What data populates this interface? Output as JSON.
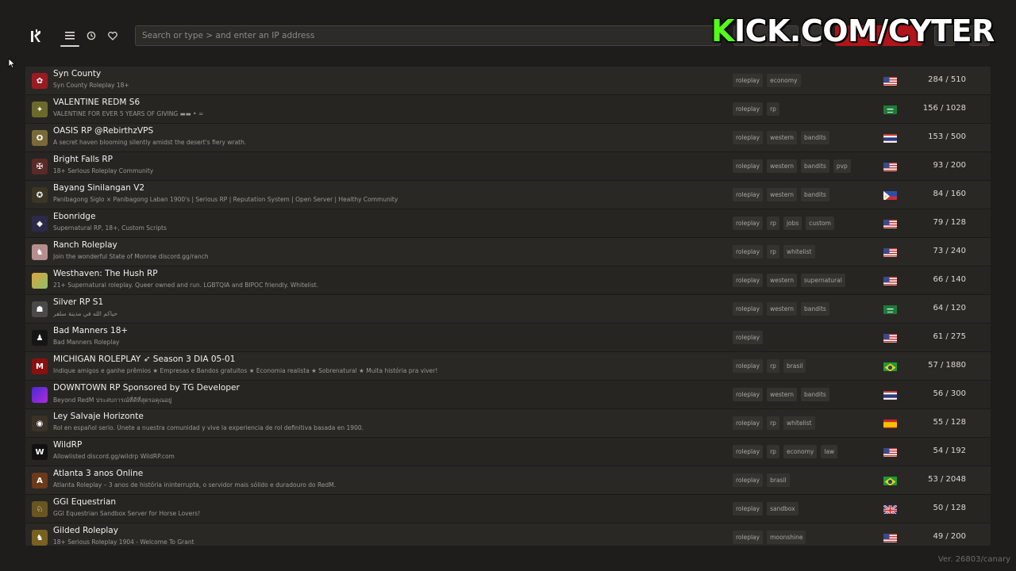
{
  "search": {
    "placeholder": "Search or type > and enter an IP address"
  },
  "overlay": {
    "kick_first": "K",
    "kick_rest": "ICK.COM/CYTER"
  },
  "version": "Ver. 26803/canary",
  "colors": {
    "accent": "#b1141a",
    "kick_green": "#53fc18"
  },
  "servers": [
    {
      "name": "Syn County",
      "desc": "Syn County Roleplay 18+",
      "tags": [
        "roleplay",
        "economy"
      ],
      "flag": "us",
      "players": "284 / 510",
      "icon": {
        "color": "#9b1b22",
        "glyph": "✿"
      }
    },
    {
      "name": "VALENTINE REDM S6",
      "desc": "VALENTINE FOR EVER 5 YEARS OF GIVING ▬▬ • ≈",
      "tags": [
        "roleplay",
        "rp"
      ],
      "flag": "sa",
      "players": "156 / 1028",
      "icon": {
        "color": "#6b6a2a",
        "glyph": "✦"
      }
    },
    {
      "name": "OASIS RP @RebirthzVPS",
      "desc": "A secret haven blooming silently amidst the desert's fiery wrath.",
      "tags": [
        "roleplay",
        "western",
        "bandits"
      ],
      "flag": "th",
      "players": "153 / 500",
      "icon": {
        "color": "#7a6a3a",
        "glyph": "O"
      }
    },
    {
      "name": "Bright Falls RP",
      "desc": "18+ Serious Roleplay Community",
      "tags": [
        "roleplay",
        "western",
        "bandits",
        "pvp"
      ],
      "flag": "us",
      "players": "93 / 200",
      "icon": {
        "color": "#5a2a28",
        "glyph": "✠"
      }
    },
    {
      "name": "Bayang Sinilangan V2",
      "desc": "Panibagong Siglo × Panibagong Laban 1900's | Serious RP | Reputation System | Open Server | Healthy Community",
      "tags": [
        "roleplay",
        "western",
        "bandits"
      ],
      "flag": "ph",
      "players": "84 / 160",
      "icon": {
        "color": "#3a3524",
        "glyph": "✪"
      }
    },
    {
      "name": "Ebonridge",
      "desc": "Supernatural RP, 18+, Custom Scripts",
      "tags": [
        "roleplay",
        "rp",
        "jobs",
        "custom"
      ],
      "flag": "us",
      "players": "79 / 128",
      "icon": {
        "color": "#2c2a4a",
        "glyph": "◆"
      }
    },
    {
      "name": "Ranch Roleplay",
      "desc": "Join the wonderful State of Monroe discord.gg/ranch",
      "tags": [
        "roleplay",
        "rp",
        "whitelist"
      ],
      "flag": "us",
      "players": "73 / 240",
      "icon": {
        "color": "#b68e8e",
        "glyph": "♞"
      }
    },
    {
      "name": "Westhaven: The Hush RP",
      "desc": "21+ Supernatural roleplay. Queer owned and run. LGBTQIA and BIPOC friendly. Whitelist.",
      "tags": [
        "roleplay",
        "western",
        "supernatural"
      ],
      "flag": "us",
      "players": "66 / 140",
      "icon": {
        "color": "#c9a040",
        "glyph": ""
      }
    },
    {
      "name": "Silver RP S1",
      "desc": "حياكم الله في مدينة سلفر",
      "tags": [
        "roleplay",
        "western",
        "bandits"
      ],
      "flag": "sa",
      "players": "64 / 120",
      "icon": {
        "color": "#4a4a4a",
        "glyph": "☗"
      }
    },
    {
      "name": "Bad Manners 18+",
      "desc": "Bad Manners Roleplay",
      "tags": [
        "roleplay"
      ],
      "flag": "us",
      "players": "61 / 275",
      "icon": {
        "color": "#151515",
        "glyph": "♟"
      }
    },
    {
      "name": "MICHIGAN ROLEPLAY ➶ Season 3 DIA 05-01",
      "desc": "Indique amigos e ganhe prêmios ★ Empresas e Bandos gratuitos ★ Economia realista ★ Sobrenatural ★ Muita história pra viver!",
      "tags": [
        "roleplay",
        "rp",
        "brasil"
      ],
      "flag": "br",
      "players": "57 / 1880",
      "icon": {
        "color": "#8a1010",
        "glyph": "M"
      }
    },
    {
      "name": "DOWNTOWN RP Sponsored by TG Developer",
      "desc": "Beyond RedM ประสบการณ์ที่ดีที่สุดรอคุณอยู่",
      "tags": [
        "roleplay",
        "western",
        "bandits"
      ],
      "flag": "th",
      "players": "56 / 300",
      "icon": {
        "color": "#7a2ad8",
        "glyph": ""
      }
    },
    {
      "name": "Ley Salvaje Horizonte",
      "desc": "Rol en español serio. Únete a nuestra comunidad y vive la experiencia de rol definitiva basada en 1900.",
      "tags": [
        "roleplay",
        "rp",
        "whitelist"
      ],
      "flag": "es",
      "players": "55 / 128",
      "icon": {
        "color": "#3a3228",
        "glyph": "◉"
      }
    },
    {
      "name": "WildRP",
      "desc": "Allowlisted discord.gg/wildrp WildRP.com",
      "tags": [
        "roleplay",
        "rp",
        "economy",
        "law"
      ],
      "flag": "us",
      "players": "54 / 192",
      "icon": {
        "color": "#111111",
        "glyph": "W"
      }
    },
    {
      "name": "Atlanta 3 anos Online",
      "desc": "Atlanta Roleplay – 3 anos de história ininterrupta, o servidor mais sólido e duradouro do RedM.",
      "tags": [
        "roleplay",
        "brasil"
      ],
      "flag": "br",
      "players": "53 / 2048",
      "icon": {
        "color": "#6a3a1a",
        "glyph": "A"
      }
    },
    {
      "name": "GGI Equestrian",
      "desc": "GGI Equestrian Sandbox Server for Horse Lovers!",
      "tags": [
        "roleplay",
        "sandbox"
      ],
      "flag": "gb",
      "players": "50 / 128",
      "icon": {
        "color": "#6a5520",
        "glyph": "♘"
      }
    },
    {
      "name": "Gilded Roleplay",
      "desc": "18+ Serious Roleplay 1904 - Welcome To Grant",
      "tags": [
        "roleplay",
        "moonshine"
      ],
      "flag": "us",
      "players": "49 / 200",
      "icon": {
        "color": "#7a6020",
        "glyph": "♞"
      }
    }
  ]
}
